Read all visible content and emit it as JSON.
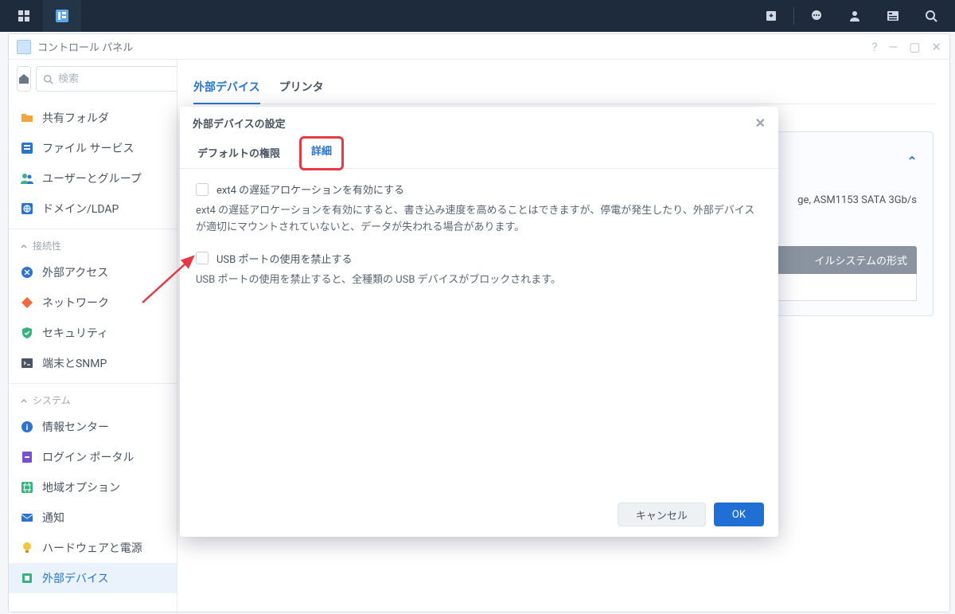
{
  "taskbar": {},
  "window": {
    "title": "コントロール パネル",
    "search_placeholder": "検索"
  },
  "sidebar": {
    "top_items": [
      {
        "label": "共有フォルダ"
      },
      {
        "label": "ファイル サービス"
      },
      {
        "label": "ユーザーとグループ"
      },
      {
        "label": "ドメイン/LDAP"
      }
    ],
    "section_connect": "接続性",
    "connect_items": [
      {
        "label": "外部アクセス"
      },
      {
        "label": "ネットワーク"
      },
      {
        "label": "セキュリティ"
      },
      {
        "label": "端末とSNMP"
      }
    ],
    "section_system": "システム",
    "system_items": [
      {
        "label": "情報センター"
      },
      {
        "label": "ログイン ポータル"
      },
      {
        "label": "地域オプション"
      },
      {
        "label": "通知"
      },
      {
        "label": "ハードウェアと電源"
      },
      {
        "label": "外部デバイス"
      }
    ]
  },
  "content": {
    "tabs": [
      {
        "label": "外部デバイス",
        "active": true
      },
      {
        "label": "プリンタ",
        "active": false
      }
    ],
    "bg_device_text": "ge, ASM1153 SATA 3Gb/s",
    "bg_table_header": "イルシステムの形式"
  },
  "modal": {
    "title": "外部デバイスの設定",
    "tabs": [
      {
        "label": "デフォルトの権限"
      },
      {
        "label": "詳細"
      }
    ],
    "opt1_label": "ext4 の遅延アロケーションを有効にする",
    "opt1_help": "ext4 の遅延アロケーションを有効にすると、書き込み速度を高めることはできますが、停電が発生したり、外部デバイスが適切にマウントされていないと、データが失われる場合があります。",
    "opt2_label": "USB ポートの使用を禁止する",
    "opt2_help": "USB ポートの使用を禁止すると、全種類の USB デバイスがブロックされます。",
    "cancel": "キャンセル",
    "ok": "OK"
  }
}
